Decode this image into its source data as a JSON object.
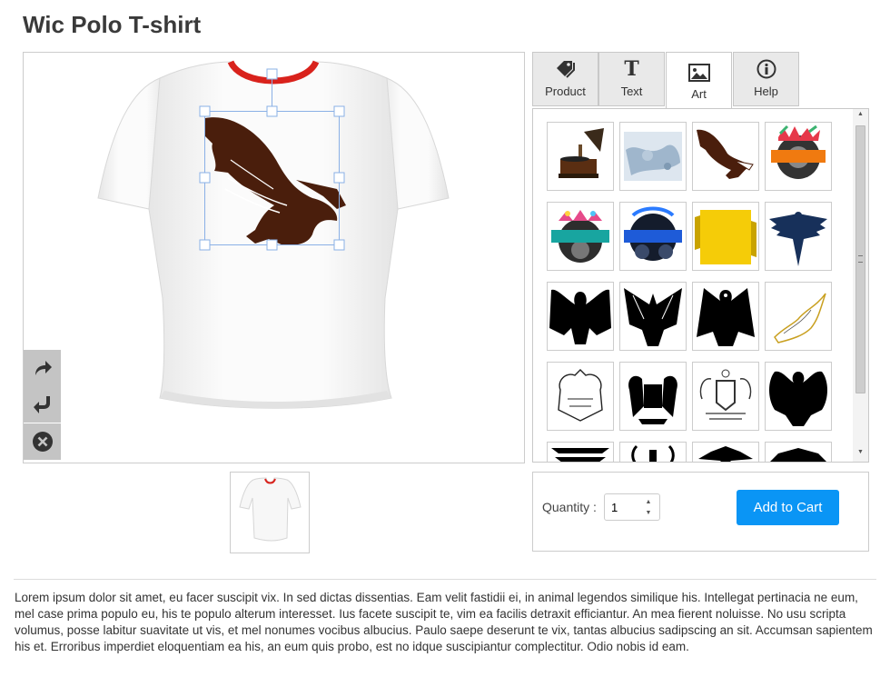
{
  "product": {
    "title": "Wic Polo T-shirt"
  },
  "tabs": [
    {
      "label": "Product",
      "icon": "tag-icon"
    },
    {
      "label": "Text",
      "icon": "text-t-icon"
    },
    {
      "label": "Art",
      "icon": "image-icon",
      "active": true
    },
    {
      "label": "Help",
      "icon": "info-icon"
    }
  ],
  "tools": [
    "redo-icon",
    "undo-icon",
    "delete-icon"
  ],
  "art_items": [
    "gramophone",
    "grunge-texture",
    "eagle-brown",
    "emblem-orange-banner",
    "emblem-teal-banner",
    "emblem-blue-banner",
    "yellow-banner",
    "blue-winged-emblem",
    "black-eagle-1",
    "black-eagle-2",
    "black-eagle-3",
    "gold-eagle-outline",
    "crest-outline",
    "lion-crest",
    "crest-shield",
    "black-eagle-4"
  ],
  "cart": {
    "quantity_label": "Quantity :",
    "quantity_value": "1",
    "add_to_cart_label": "Add to Cart"
  },
  "description": "Lorem ipsum dolor sit amet, eu facer suscipit vix. In sed dictas dissentias. Eam velit fastidii ei, in animal legendos similique his. Intellegat pertinacia ne eum, mel case prima populo eu, his te populo alterum interesset. Ius facete suscipit te, vim ea facilis detraxit efficiantur. An mea fierent noluisse. No usu scripta volumus, posse labitur suavitate ut vis, et mel nonumes vocibus albucius. Paulo saepe deserunt te vix, tantas albucius sadipscing an sit. Accumsan sapientem his et. Erroribus imperdiet eloquentiam ea his, an eum quis probo, est no idque suscipiantur complectitur. Odio nobis id eam.",
  "colors": {
    "accent": "#0a95f5",
    "collar": "#d9221c",
    "eagle": "#4a1e0c"
  }
}
